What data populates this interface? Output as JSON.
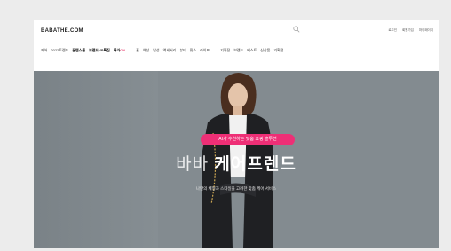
{
  "header": {
    "logo": "BABATHE.COM",
    "util_links": [
      "로그인",
      "회원가입",
      "마이페이지"
    ]
  },
  "nav": {
    "items": [
      {
        "label": "케어",
        "strong": false
      },
      {
        "label": "2022트렌드",
        "strong": false
      },
      {
        "label": "꿀템쇼룸",
        "strong": true
      },
      {
        "label": "브랜드VS특집",
        "strong": true
      },
      {
        "label": "특가",
        "strong": true,
        "badge": "ON"
      },
      {
        "label": "홈",
        "strong": false,
        "gap": true
      },
      {
        "label": "여성",
        "strong": false
      },
      {
        "label": "남성",
        "strong": false
      },
      {
        "label": "액세서리",
        "strong": false
      },
      {
        "label": "뷰티",
        "strong": false
      },
      {
        "label": "핏스",
        "strong": false
      },
      {
        "label": "라이프",
        "strong": false
      },
      {
        "label": "기획전",
        "strong": false,
        "gap": true
      },
      {
        "label": "브랜드",
        "strong": false
      },
      {
        "label": "베스트",
        "strong": false
      },
      {
        "label": "신상품",
        "strong": false
      },
      {
        "label": "기획전",
        "strong": false
      }
    ]
  },
  "hero": {
    "pill_text": "AI가 추천하는 맞춤 쇼핑 솔루션",
    "headline_light": "바바",
    "headline_bold": "케어프렌드",
    "subtext": "나만의 체형과 스타일을 고려한 맞춤 케어 서비스"
  },
  "colors": {
    "accent": "#ee2f76",
    "hero_bg": "#838b90"
  }
}
